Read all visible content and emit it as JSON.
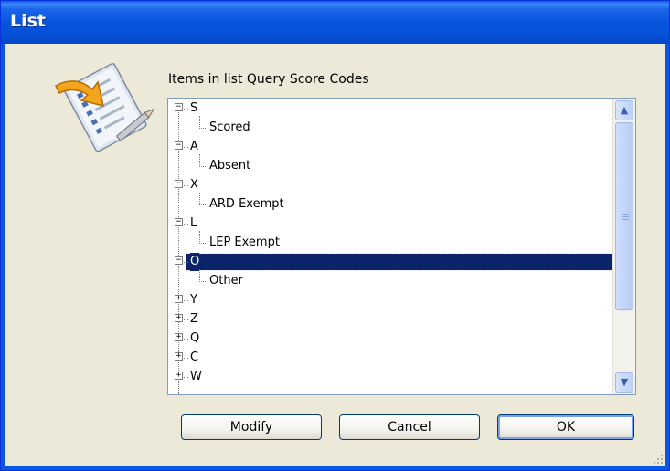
{
  "window": {
    "title": "List"
  },
  "label": "Items in list Query Score Codes",
  "tree": [
    {
      "code": "S",
      "expanded": true,
      "child": "Scored"
    },
    {
      "code": "A",
      "expanded": true,
      "child": "Absent"
    },
    {
      "code": "X",
      "expanded": true,
      "child": "ARD Exempt"
    },
    {
      "code": "L",
      "expanded": true,
      "child": "LEP Exempt"
    },
    {
      "code": "O",
      "expanded": true,
      "child": "Other",
      "selected": true
    },
    {
      "code": "Y",
      "expanded": false
    },
    {
      "code": "Z",
      "expanded": false
    },
    {
      "code": "Q",
      "expanded": false
    },
    {
      "code": "C",
      "expanded": false
    },
    {
      "code": "W",
      "expanded": false
    }
  ],
  "buttons": {
    "modify": "Modify",
    "cancel": "Cancel",
    "ok": "OK"
  },
  "colors": {
    "titlebar": "#0855dd",
    "selection": "#0a246a",
    "dialog_bg": "#ece9d8"
  }
}
